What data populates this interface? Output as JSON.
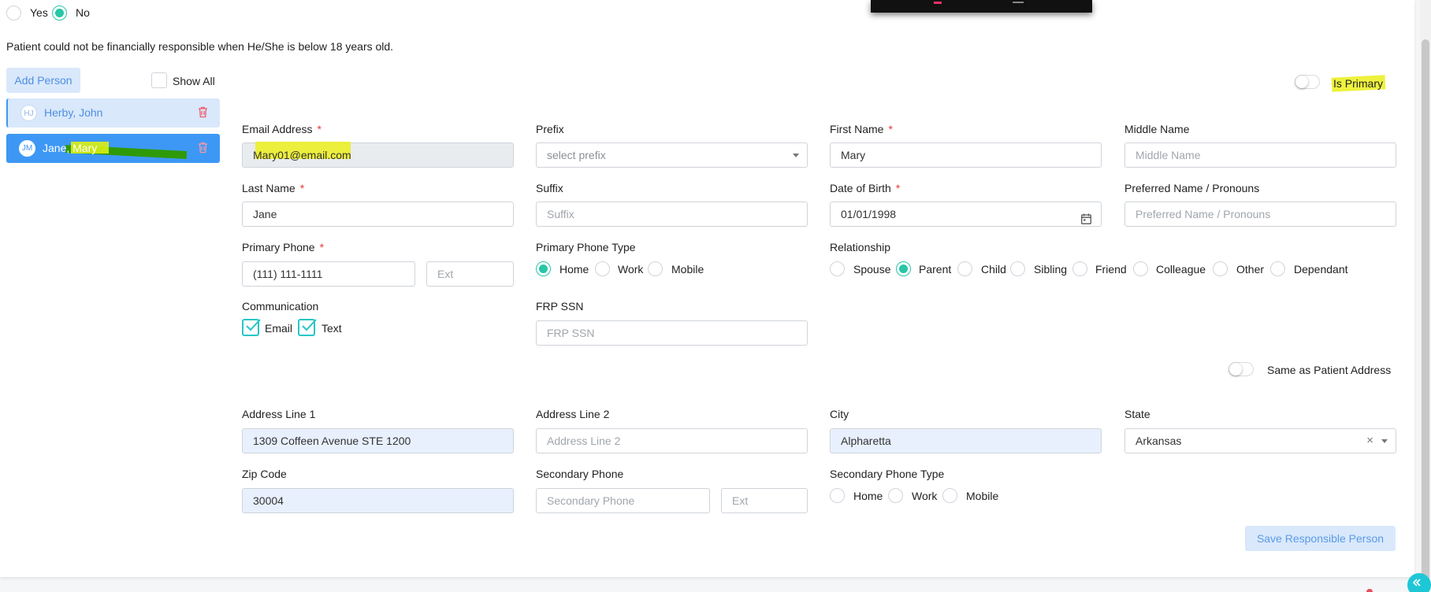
{
  "top_radio": {
    "yes": "Yes",
    "no": "No",
    "selected": "No"
  },
  "notice": "Patient could not be financially responsible when He/She is below 18 years old.",
  "sidebar": {
    "add_person": "Add Person",
    "show_all": "Show All",
    "persons": [
      {
        "initials": "HJ",
        "name": "Herby, John",
        "selected": false
      },
      {
        "initials": "JM",
        "name": "Jane, Mary",
        "selected": true
      }
    ]
  },
  "is_primary": "Is Primary",
  "form": {
    "email": {
      "label": "Email Address",
      "value": "Mary01@email.com"
    },
    "prefix": {
      "label": "Prefix",
      "placeholder": "select prefix"
    },
    "first_name": {
      "label": "First Name",
      "value": "Mary"
    },
    "middle_name": {
      "label": "Middle Name",
      "placeholder": "Middle Name"
    },
    "last_name": {
      "label": "Last Name",
      "value": "Jane"
    },
    "suffix": {
      "label": "Suffix",
      "placeholder": "Suffix"
    },
    "dob": {
      "label": "Date of Birth",
      "value": "01/01/1998"
    },
    "preferred": {
      "label": "Preferred Name / Pronouns",
      "placeholder": "Preferred Name / Pronouns"
    },
    "primary_phone": {
      "label": "Primary Phone",
      "value": "(111) 111-1111",
      "ext_placeholder": "Ext"
    },
    "primary_phone_type": {
      "label": "Primary Phone Type",
      "options": [
        "Home",
        "Work",
        "Mobile"
      ],
      "selected": "Home"
    },
    "relationship": {
      "label": "Relationship",
      "options": [
        "Spouse",
        "Parent",
        "Child",
        "Sibling",
        "Friend",
        "Colleague",
        "Other",
        "Dependant"
      ],
      "selected": "Parent"
    },
    "communication": {
      "label": "Communication",
      "email": "Email",
      "text": "Text"
    },
    "frp_ssn": {
      "label": "FRP SSN",
      "placeholder": "FRP SSN"
    },
    "same_as_patient": "Same as Patient Address",
    "address1": {
      "label": "Address Line 1",
      "value": "1309 Coffeen Avenue STE 1200"
    },
    "address2": {
      "label": "Address Line 2",
      "placeholder": "Address Line 2"
    },
    "city": {
      "label": "City",
      "value": "Alpharetta"
    },
    "state": {
      "label": "State",
      "value": "Arkansas"
    },
    "zip": {
      "label": "Zip Code",
      "value": "30004"
    },
    "secondary_phone": {
      "label": "Secondary Phone",
      "placeholder": "Secondary Phone",
      "ext_placeholder": "Ext"
    },
    "secondary_phone_type": {
      "label": "Secondary Phone Type",
      "options": [
        "Home",
        "Work",
        "Mobile"
      ]
    }
  },
  "save_button": "Save Responsible Person",
  "colors": {
    "accent": "#27c6a6",
    "primary_blue": "#3d98f5",
    "required": "#e53935"
  }
}
